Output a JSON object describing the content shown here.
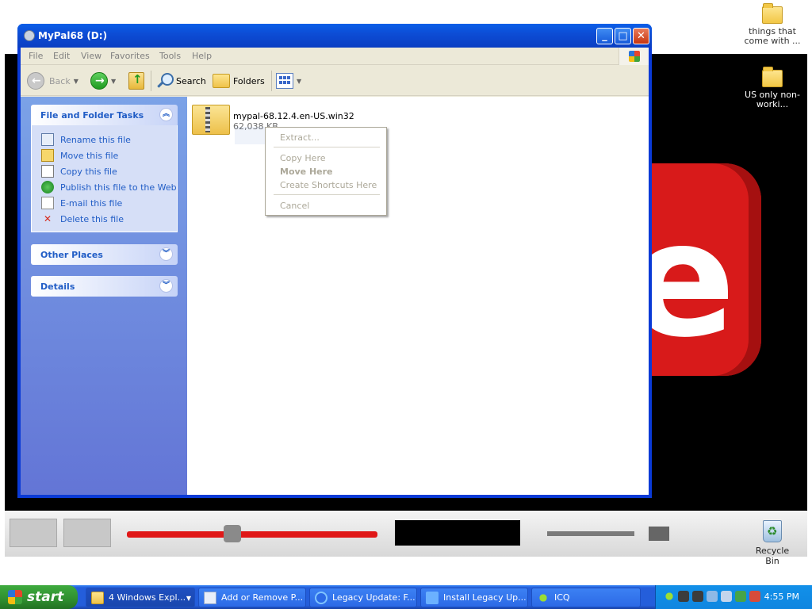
{
  "desktop": {
    "icons": [
      {
        "label": "things that come with ..."
      },
      {
        "label": "US only non-worki..."
      }
    ],
    "recycle_bin": "Recycle Bin"
  },
  "window": {
    "title": "MyPal68 (D:)",
    "buttons": {
      "minimize": "_",
      "maximize": "□",
      "close": "✕"
    },
    "menu": [
      "File",
      "Edit",
      "View",
      "Favorites",
      "Tools",
      "Help"
    ],
    "toolbar": {
      "back": "Back",
      "search": "Search",
      "folders": "Folders"
    },
    "taskpane": {
      "file_tasks": {
        "title": "File and Folder Tasks",
        "items": [
          {
            "label": "Rename this file",
            "icon": "rename-icon"
          },
          {
            "label": "Move this file",
            "icon": "move-icon"
          },
          {
            "label": "Copy this file",
            "icon": "copy-icon"
          },
          {
            "label": "Publish this file to the Web",
            "icon": "globe-icon"
          },
          {
            "label": "E-mail this file",
            "icon": "email-icon"
          },
          {
            "label": "Delete this file",
            "icon": "delete-icon"
          }
        ]
      },
      "other_places": {
        "title": "Other Places"
      },
      "details": {
        "title": "Details"
      }
    },
    "file": {
      "name": "mypal-68.12.4.en-US.win32",
      "size": "62,038 KB"
    }
  },
  "context_menu": {
    "items": [
      {
        "label": "Extract...",
        "bold": false
      },
      {
        "label": "Copy Here",
        "bold": false
      },
      {
        "label": "Move Here",
        "bold": true
      },
      {
        "label": "Create Shortcuts Here",
        "bold": false
      },
      {
        "label": "Cancel",
        "bold": false
      }
    ]
  },
  "taskbar": {
    "start": "start",
    "buttons": [
      {
        "label": "4 Windows Expl...",
        "icon": "folder-icon"
      },
      {
        "label": "Add or Remove P...",
        "icon": "add-remove-icon"
      },
      {
        "label": "Legacy Update: F...",
        "icon": "ie-icon"
      },
      {
        "label": "Install Legacy Up...",
        "icon": "install-icon"
      },
      {
        "label": "ICQ",
        "icon": "icq-icon"
      }
    ],
    "clock": "4:55 PM"
  },
  "colors": {
    "title_bar": "#0a3ec2",
    "taskpane_link": "#215dc6",
    "taskbar": "#245edb",
    "start_green": "#2f8e2f",
    "video_red": "#d81a1a"
  }
}
